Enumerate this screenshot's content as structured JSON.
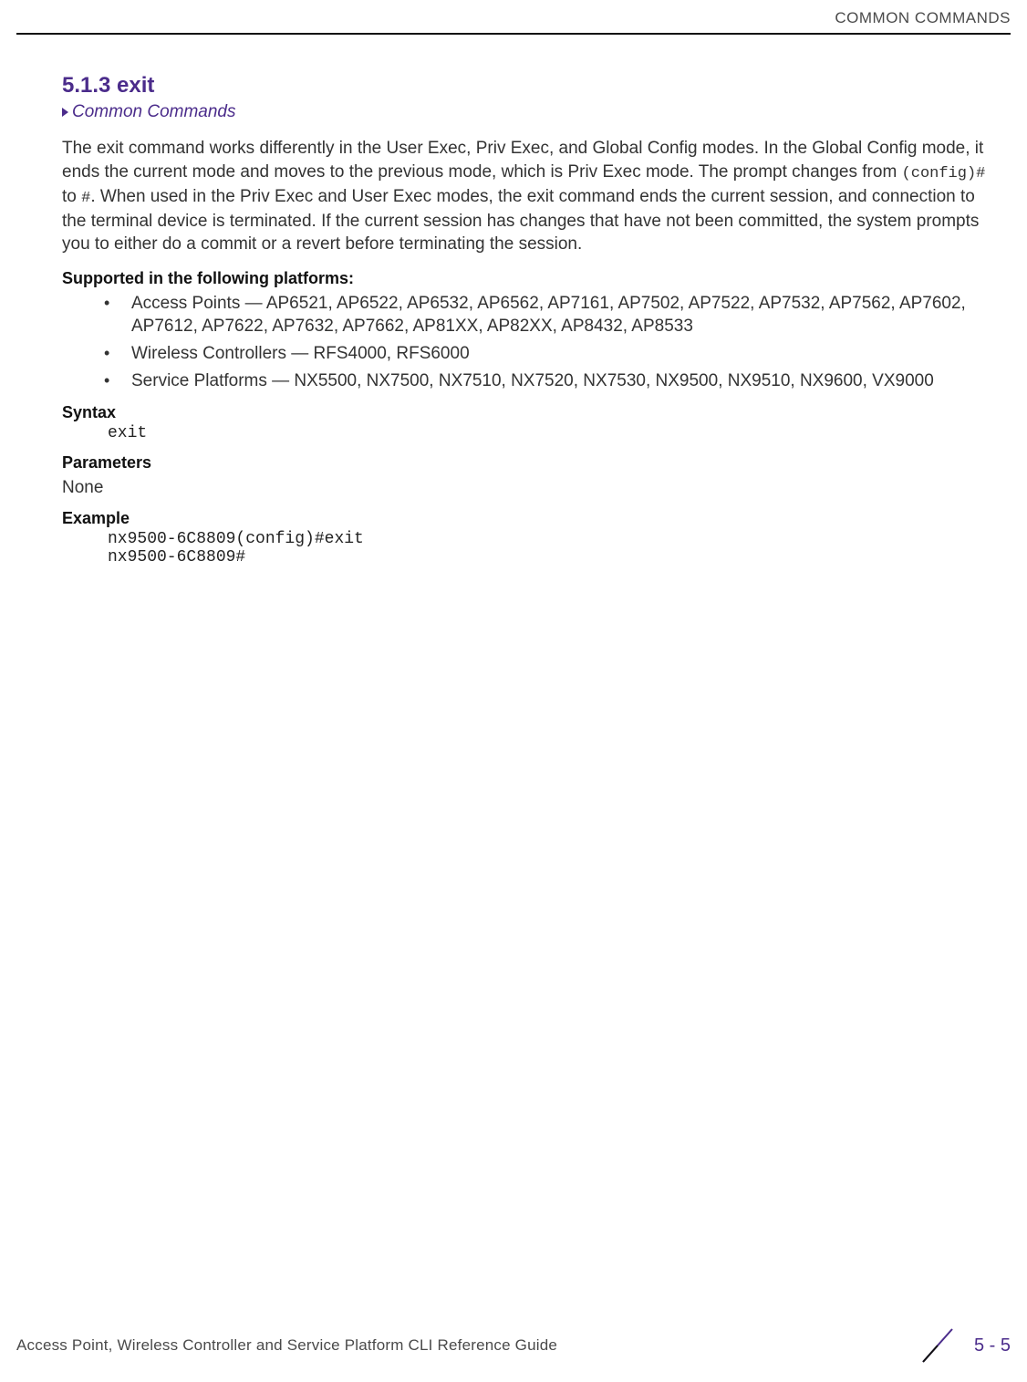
{
  "header": {
    "running_head": "COMMON COMMANDS"
  },
  "section": {
    "number_title": "5.1.3 exit",
    "subhead_link": "Common Commands"
  },
  "body": {
    "para1_a": "The exit command works differently in the User Exec, Priv Exec, and Global Config modes. In the Global Config mode, it ends the current mode and moves to the previous mode, which is Priv Exec mode. The prompt changes from ",
    "para1_code1": "(config)#",
    "para1_b": " to ",
    "para1_code2": "#",
    "para1_c": ". When used in the Priv Exec and User Exec modes, the exit command ends the current session, and connection to the terminal device is terminated. If the current session has changes that have not been committed, the system prompts you to either do a commit or a revert before terminating the session."
  },
  "supported": {
    "heading": "Supported in the following platforms:",
    "items": [
      "Access Points — AP6521, AP6522, AP6532, AP6562, AP7161, AP7502, AP7522, AP7532, AP7562, AP7602, AP7612, AP7622, AP7632, AP7662, AP81XX, AP82XX, AP8432, AP8533",
      "Wireless Controllers — RFS4000, RFS6000",
      "Service Platforms — NX5500, NX7500, NX7510, NX7520, NX7530, NX9500, NX9510, NX9600, VX9000"
    ]
  },
  "syntax": {
    "heading": "Syntax",
    "code": "exit"
  },
  "parameters": {
    "heading": "Parameters",
    "value": "None"
  },
  "example": {
    "heading": "Example",
    "code": "nx9500-6C8809(config)#exit\nnx9500-6C8809#"
  },
  "footer": {
    "title": "Access Point, Wireless Controller and Service Platform CLI Reference Guide",
    "pagenum": "5 - 5"
  }
}
